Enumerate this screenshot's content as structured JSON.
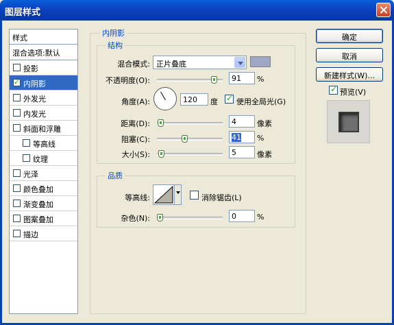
{
  "window": {
    "title": "图层样式"
  },
  "styles": {
    "header": "样式",
    "blend_options": "混合选项:默认",
    "items": [
      {
        "label": "投影",
        "checked": false,
        "selected": false,
        "indent": false
      },
      {
        "label": "内阴影",
        "checked": true,
        "selected": true,
        "indent": false
      },
      {
        "label": "外发光",
        "checked": false,
        "selected": false,
        "indent": false
      },
      {
        "label": "内发光",
        "checked": false,
        "selected": false,
        "indent": false
      },
      {
        "label": "斜面和浮雕",
        "checked": false,
        "selected": false,
        "indent": false
      },
      {
        "label": "等高线",
        "checked": false,
        "selected": false,
        "indent": true
      },
      {
        "label": "纹理",
        "checked": false,
        "selected": false,
        "indent": true
      },
      {
        "label": "光泽",
        "checked": false,
        "selected": false,
        "indent": false
      },
      {
        "label": "颜色叠加",
        "checked": false,
        "selected": false,
        "indent": false
      },
      {
        "label": "渐变叠加",
        "checked": false,
        "selected": false,
        "indent": false
      },
      {
        "label": "图案叠加",
        "checked": false,
        "selected": false,
        "indent": false
      },
      {
        "label": "描边",
        "checked": false,
        "selected": false,
        "indent": false
      }
    ]
  },
  "inner_shadow": {
    "title": "内阴影",
    "structure": {
      "title": "结构",
      "blend_mode_label": "混合模式:",
      "blend_mode_value": "正片叠底",
      "shadow_color": "#a0a8c8",
      "opacity_label": "不透明度(O):",
      "opacity_value": "91",
      "opacity_unit": "%",
      "angle_label": "角度(A):",
      "angle_value": "120",
      "angle_unit": "度",
      "global_light_label": "使用全局光(G)",
      "global_light_checked": true,
      "distance_label": "距离(D):",
      "distance_value": "4",
      "distance_unit": "像素",
      "choke_label": "阻塞(C):",
      "choke_value": "41",
      "choke_unit": "%",
      "size_label": "大小(S):",
      "size_value": "5",
      "size_unit": "像素"
    },
    "quality": {
      "title": "品质",
      "contour_label": "等高线:",
      "anti_alias_label": "消除锯齿(L)",
      "anti_alias_checked": false,
      "noise_label": "杂色(N):",
      "noise_value": "0",
      "noise_unit": "%"
    }
  },
  "buttons": {
    "ok": "确定",
    "cancel": "取消",
    "new_style": "新建样式(W)...",
    "preview_label": "预览(V)",
    "preview_checked": true
  }
}
